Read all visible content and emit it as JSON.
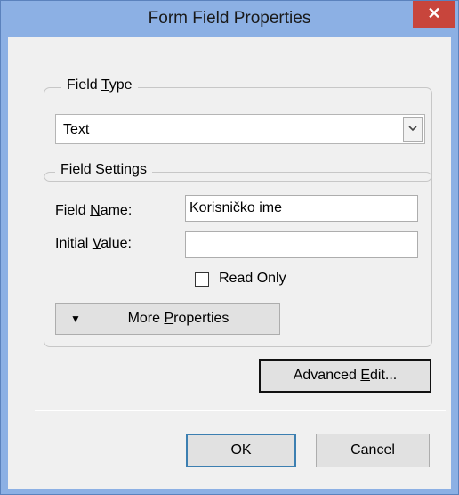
{
  "window": {
    "title": "Form Field Properties",
    "close_glyph": "✕"
  },
  "field_type": {
    "legend": "Field Type",
    "selected": "Text",
    "dropdown_icon": "chevron-down-icon"
  },
  "field_settings": {
    "legend": "Field Settings",
    "field_name_label": "Field Name:",
    "field_name_value": "Korisničko ime",
    "initial_value_label": "Initial Value:",
    "initial_value": "",
    "read_only_label": "Read Only",
    "read_only_checked": false,
    "more_properties_label": "More Properties"
  },
  "buttons": {
    "advanced_edit": "Advanced Edit...",
    "ok": "OK",
    "cancel": "Cancel"
  }
}
